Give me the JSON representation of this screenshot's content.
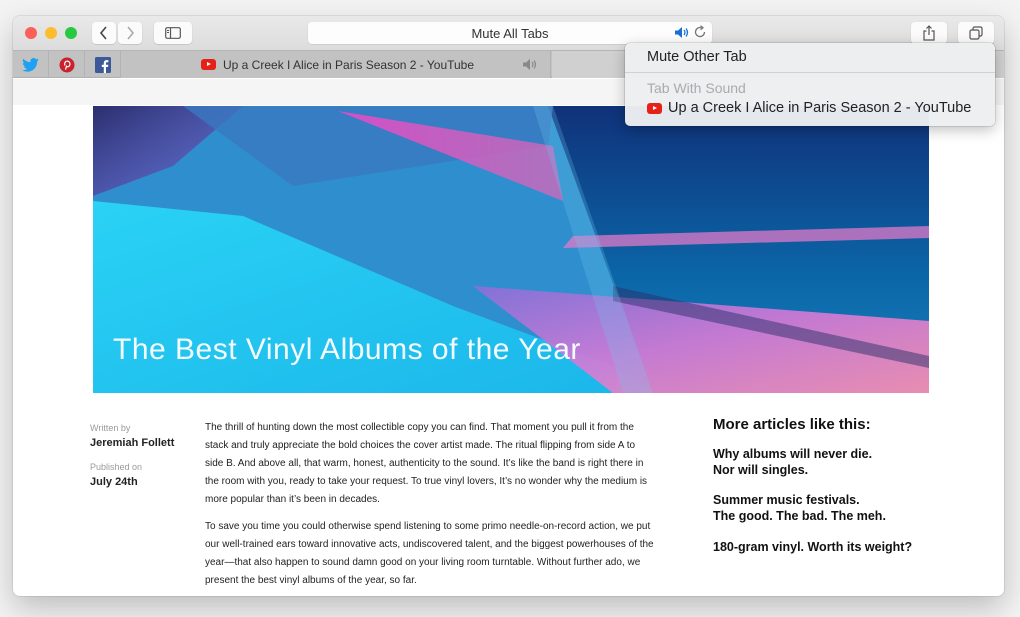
{
  "browser": {
    "address_bar_text": "Mute All Tabs",
    "toolbar_buttons": {
      "back": "chevron-left-icon",
      "forward": "chevron-right-icon",
      "sidebar": "sidebar-icon",
      "share": "share-icon",
      "tabs_overview": "tabs-icon"
    },
    "pinned_tabs": [
      {
        "name": "Twitter",
        "icon": "twitter-icon",
        "color": "#1da1f2"
      },
      {
        "name": "Pinterest",
        "icon": "pinterest-icon",
        "color": "#c8232c"
      },
      {
        "name": "Facebook",
        "icon": "facebook-icon",
        "color": "#3b5998"
      }
    ],
    "tabs": [
      {
        "title": "Up a Creek I Alice in Paris Season 2 - YouTube",
        "playing_audio": true
      }
    ]
  },
  "mute_menu": {
    "items": [
      {
        "label": "Mute Other Tab",
        "enabled": true
      }
    ],
    "section_header": "Tab With Sound",
    "sound_tabs": [
      {
        "label": "Up a Creek I Alice in Paris Season 2 - YouTube"
      }
    ]
  },
  "article": {
    "hero_title": "The Best Vinyl Albums of the Year",
    "written_by_label": "Written by",
    "author": "Jeremiah Follett",
    "published_label": "Published on",
    "published_date": "July 24th",
    "paragraphs": [
      "The thrill of hunting down the most collectible copy you can find. That moment you pull it from the stack and truly appreciate the bold choices the cover artist made. The ritual flipping from side A to side B. And above all, that warm, honest, authenticity to the sound. It’s like the band is right there in the room with you, ready to take your request. To true vinyl lovers, It’s no wonder why the medium is more popular than it’s been in decades.",
      "To save you time you could otherwise spend listening to some primo needle-on-record action, we put our well-trained ears toward innovative acts, undiscovered talent, and the biggest powerhouses of the year—that also happen to sound damn good on your living room turntable. Without further ado, we present the best vinyl albums of the year, so far."
    ]
  },
  "sidebar": {
    "title": "More articles like this:",
    "links": [
      "Why albums will never die.\nNor will singles.",
      "Summer music festivals.\nThe good. The bad. The meh.",
      "180-gram vinyl. Worth its weight?"
    ]
  },
  "colors": {
    "accent_speaker": "#1a6fd6",
    "youtube_red": "#e62117"
  }
}
